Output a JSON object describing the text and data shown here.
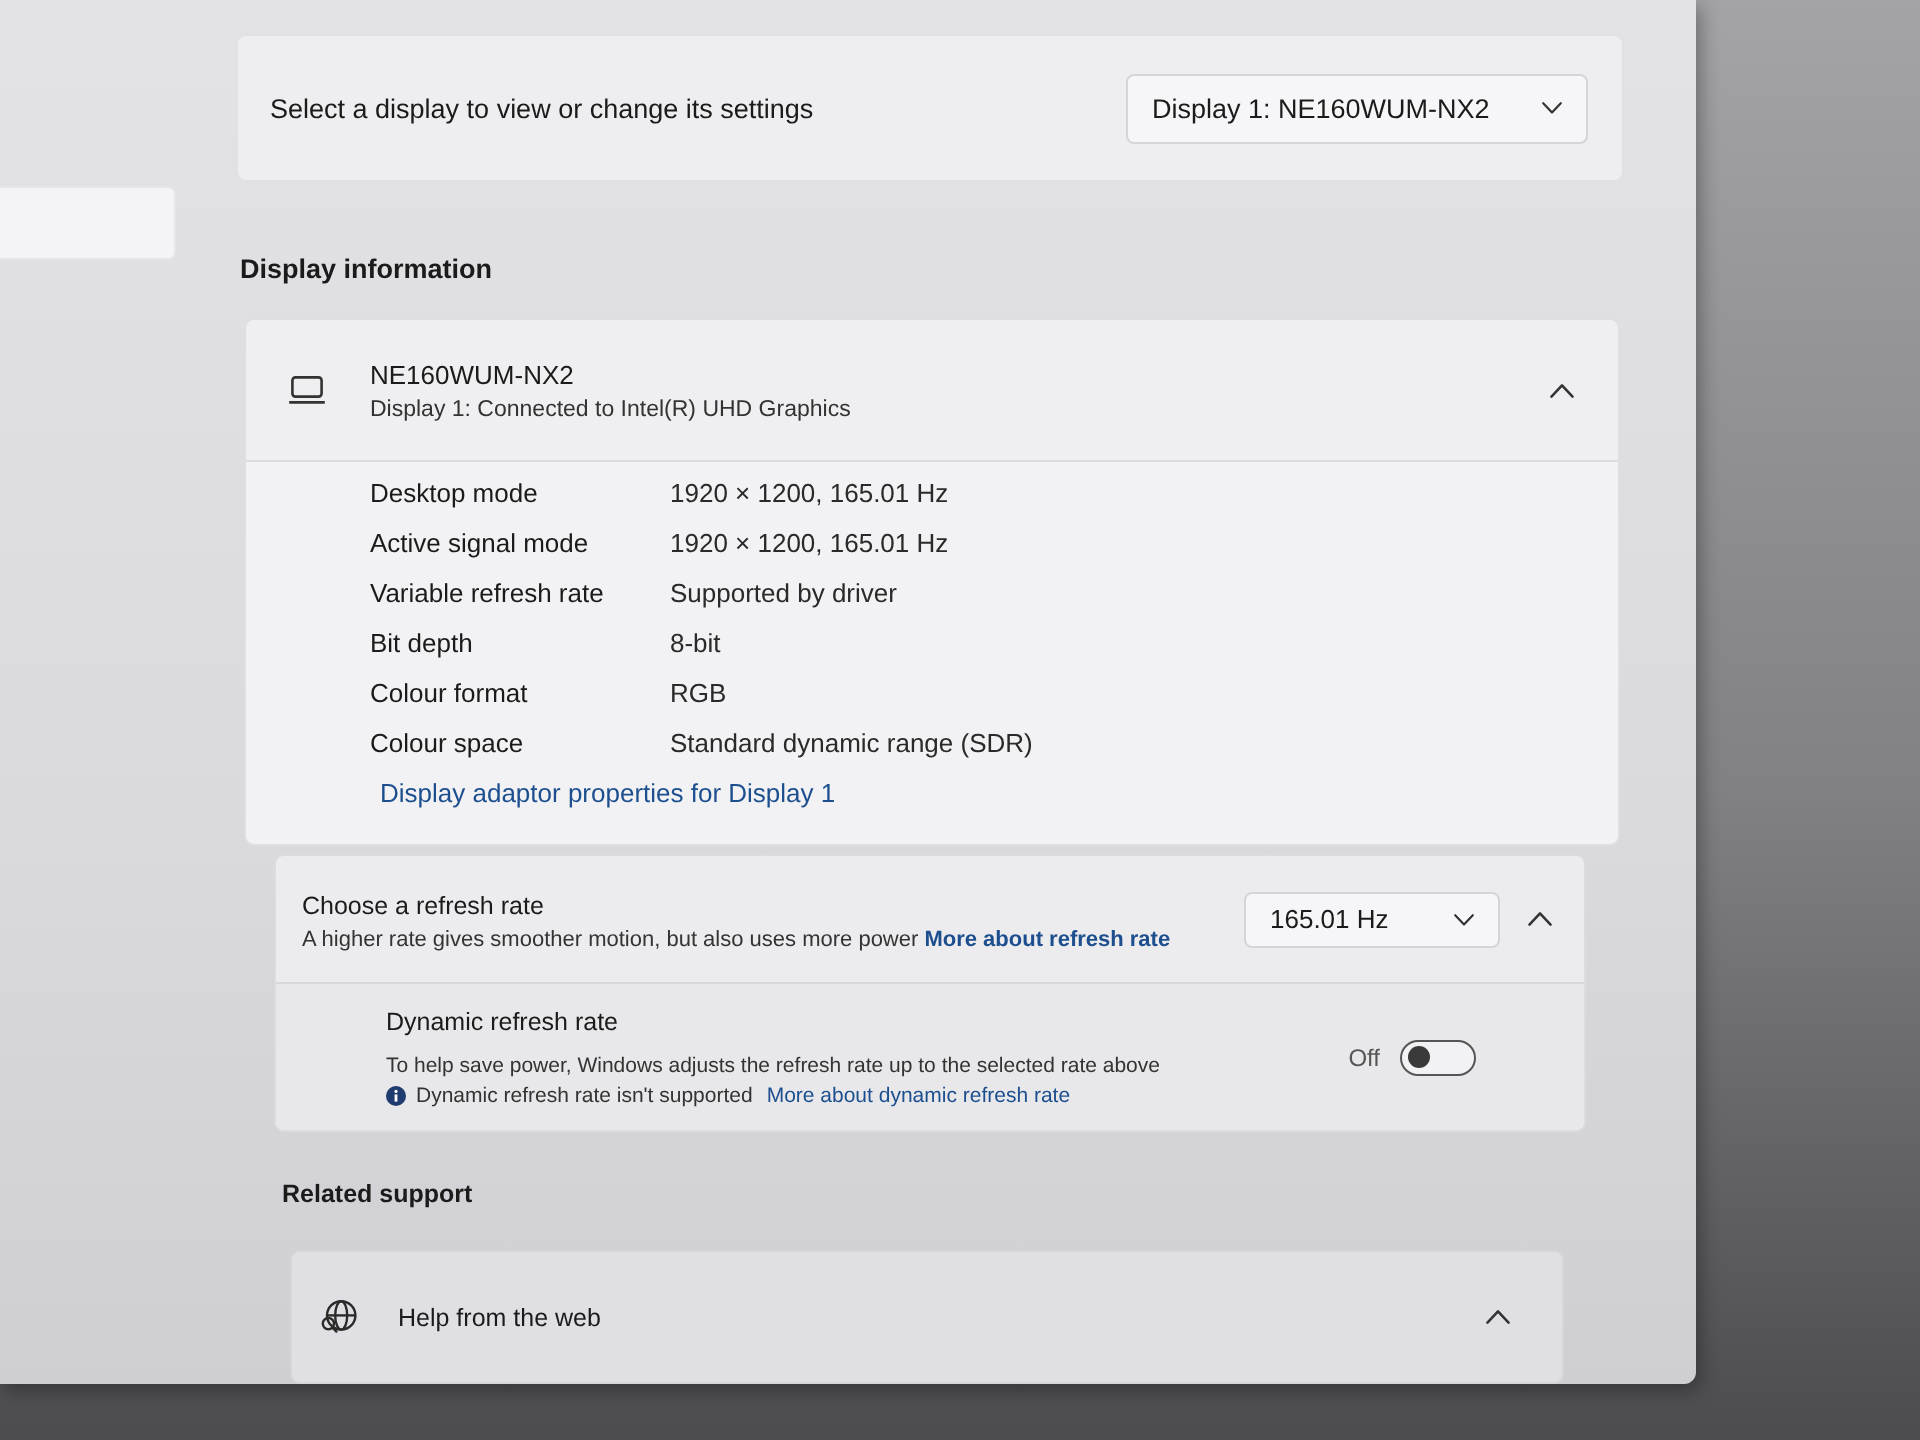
{
  "sidebar": {
    "items": [
      {
        "selected": true
      }
    ]
  },
  "display_selector": {
    "label": "Select a display to view or change its settings",
    "value": "Display 1: NE160WUM-NX2"
  },
  "display_information": {
    "heading": "Display information",
    "monitor": {
      "name": "NE160WUM-NX2",
      "connection": "Display 1: Connected to Intel(R) UHD Graphics",
      "expanded": true
    },
    "properties": [
      {
        "label": "Desktop mode",
        "value": "1920 × 1200, 165.01 Hz"
      },
      {
        "label": "Active signal mode",
        "value": "1920 × 1200, 165.01 Hz"
      },
      {
        "label": "Variable refresh rate",
        "value": "Supported by driver"
      },
      {
        "label": "Bit depth",
        "value": "8-bit"
      },
      {
        "label": "Colour format",
        "value": "RGB"
      },
      {
        "label": "Colour space",
        "value": "Standard dynamic range (SDR)"
      }
    ],
    "link": "Display adaptor properties for Display 1"
  },
  "refresh_rate": {
    "title": "Choose a refresh rate",
    "description": "A higher rate gives smoother motion, but also uses more power",
    "link": "More about refresh rate",
    "value": "165.01 Hz",
    "expanded": true,
    "dynamic_refresh": {
      "title": "Dynamic refresh rate",
      "description": "To help save power, Windows adjusts the refresh rate up to the selected rate above",
      "notice": "Dynamic refresh rate isn't supported",
      "link": "More about dynamic refresh rate",
      "toggle_label": "Off",
      "on": false
    }
  },
  "related_support": {
    "heading": "Related support",
    "items": [
      {
        "label": "Help from the web",
        "expanded": true
      }
    ]
  }
}
